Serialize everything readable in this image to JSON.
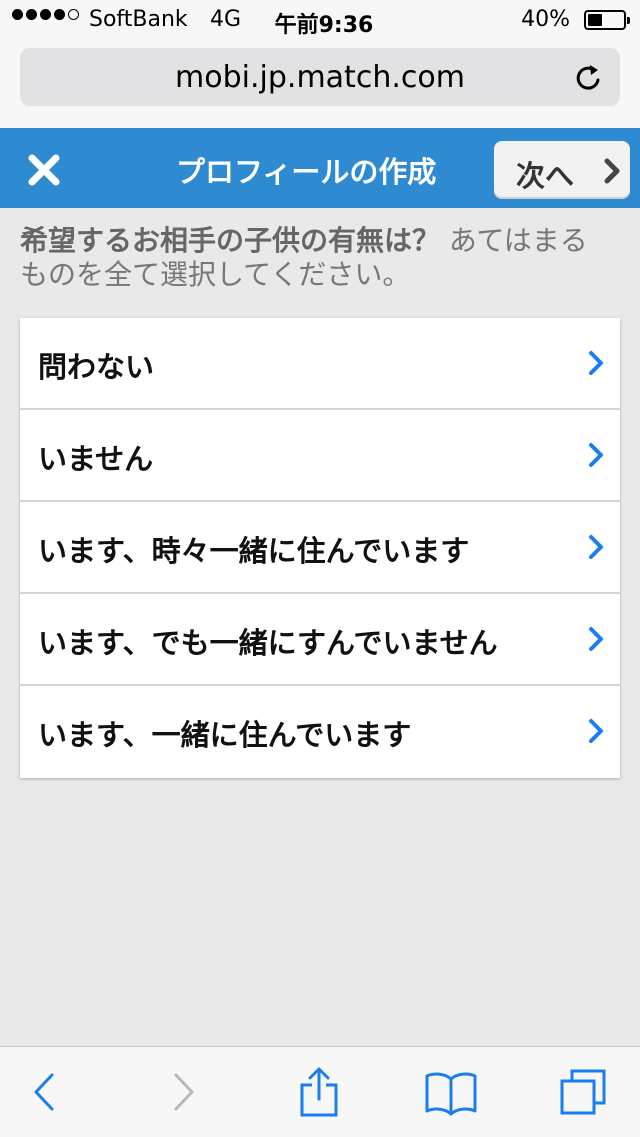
{
  "status_bar": {
    "carrier": "SoftBank",
    "network": "4G",
    "time": "午前9:36",
    "battery_percent": "40%",
    "battery_level": 0.4,
    "signal_bars": 4,
    "signal_total": 5
  },
  "browser": {
    "url": "mobi.jp.match.com",
    "reload_icon": "reload-icon"
  },
  "header": {
    "title": "プロフィールの作成",
    "close_icon": "close-icon",
    "next_label": "次へ",
    "next_icon": "chevron-right-icon",
    "background_color": "#2f8bd1"
  },
  "question": {
    "main": "希望するお相手の子供の有無は？",
    "hint": "あてはまるものを全て選択してください。"
  },
  "options": [
    {
      "label": "問わない"
    },
    {
      "label": "いません"
    },
    {
      "label": "います、時々一緒に住んでいます"
    },
    {
      "label": "います、でも一緒にすんでいません"
    },
    {
      "label": "います、一緒に住んでいます"
    }
  ],
  "toolbar": {
    "icons": [
      "back-icon",
      "forward-icon",
      "share-icon",
      "bookmarks-icon",
      "tabs-icon"
    ],
    "accent_color": "#1a7ef0"
  }
}
